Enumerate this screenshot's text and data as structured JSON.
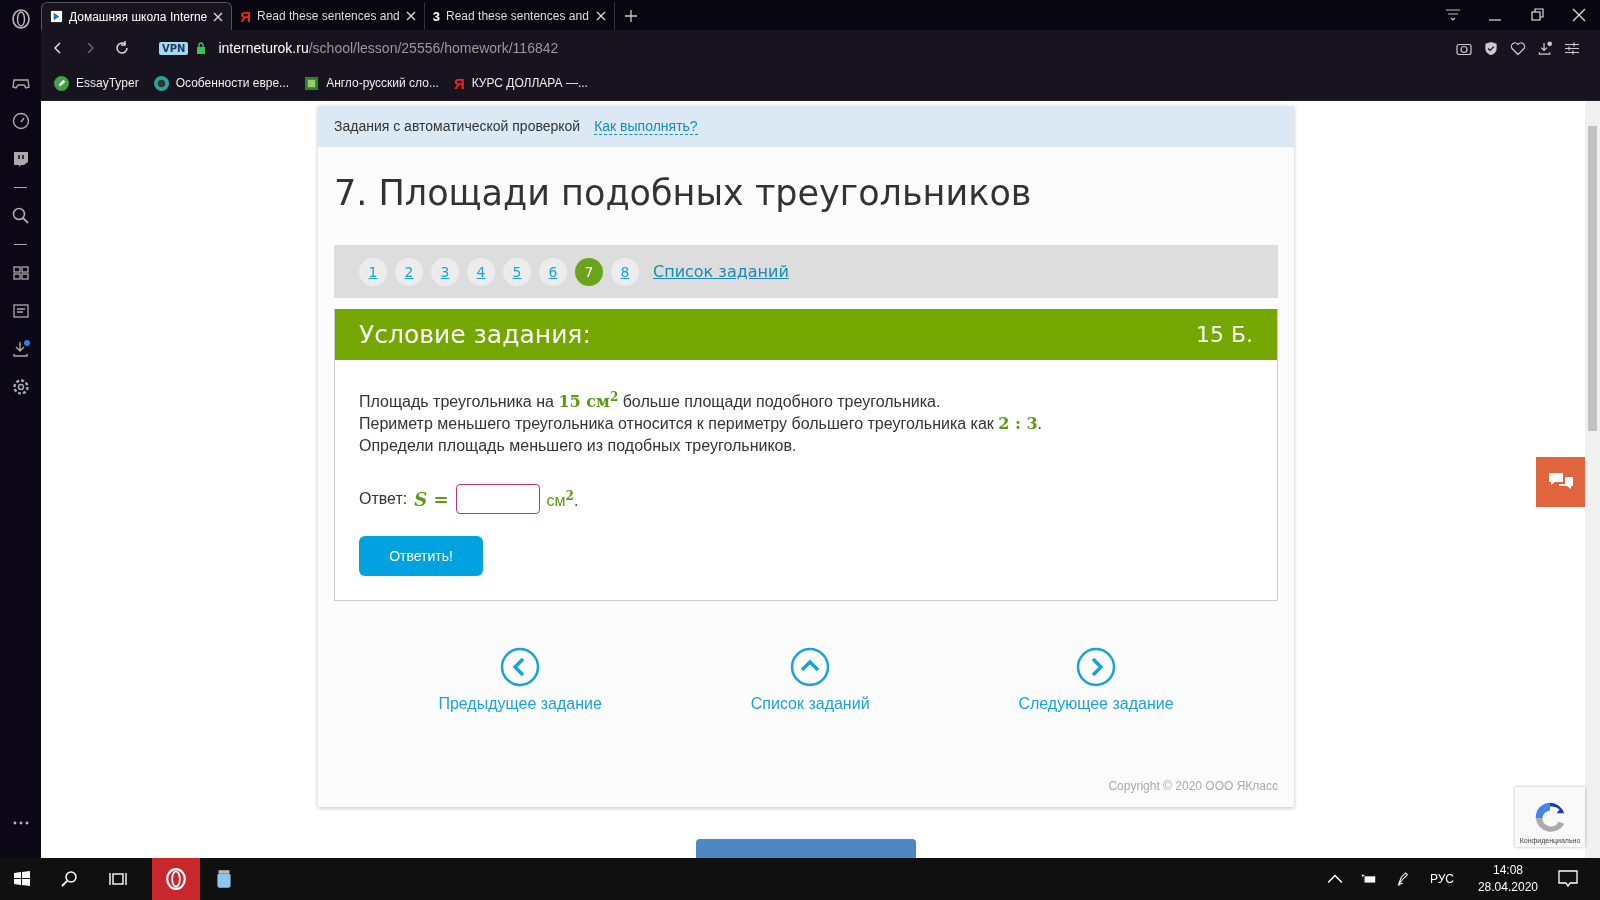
{
  "browser": {
    "tabs": [
      {
        "title": "Домашняя школа Interne",
        "selected": true
      },
      {
        "title": "Read these sentences and",
        "selected": false,
        "glyph": "Я"
      },
      {
        "title": "Read these sentences and",
        "selected": false,
        "glyph": "3"
      }
    ],
    "vpn": "VPN",
    "url_host": "interneturok.ru",
    "url_path": "/school/lesson/25556/homework/116842",
    "bookmarks": [
      {
        "label": "EssayTyper"
      },
      {
        "label": "Особенности евре..."
      },
      {
        "label": "Англо-русский сло..."
      },
      {
        "label": "КУРС ДОЛЛАРА —...",
        "glyph": "Я"
      }
    ]
  },
  "page": {
    "info_bar": {
      "text": "Задания с автоматической проверкой",
      "link": "Как выполнять?"
    },
    "title": "7. Площади подобных треугольников",
    "pager": {
      "pages": [
        {
          "label": "1",
          "selected": false
        },
        {
          "label": "2",
          "selected": false
        },
        {
          "label": "3",
          "selected": false
        },
        {
          "label": "4",
          "selected": false
        },
        {
          "label": "5",
          "selected": false
        },
        {
          "label": "6",
          "selected": false
        },
        {
          "label": "7",
          "selected": true
        },
        {
          "label": "8",
          "selected": false
        }
      ],
      "list_link": "Список заданий"
    },
    "task": {
      "header": "Условие задания:",
      "points": "15 Б.",
      "lines": [
        [
          {
            "kind": "text",
            "text": "Площадь треугольника на "
          },
          {
            "kind": "math",
            "text": "15 см$^{2}$"
          },
          {
            "kind": "text",
            "text": " больше площади подобного треугольника."
          }
        ],
        [
          {
            "kind": "text",
            "text": "Периметр меньшего треугольника относится к периметру большего треугольника как "
          },
          {
            "kind": "math",
            "text": "2 : 3"
          },
          {
            "kind": "text",
            "text": "."
          }
        ],
        [
          {
            "kind": "text",
            "text": "Определи площадь меньшего из подобных треугольников."
          }
        ]
      ],
      "answer_label": "Ответ:",
      "answer_lhs": "S =",
      "answer_unit": "см$^{2}$",
      "answer_end": ".",
      "submit": "Ответить!"
    },
    "nav": [
      {
        "kind": "prev",
        "label": "Предыдущее задание"
      },
      {
        "kind": "up",
        "label": "Список заданий"
      },
      {
        "kind": "next",
        "label": "Следующее задание"
      }
    ],
    "copyright": "Copyright © 2020 ООО ЯКласс",
    "recaptcha": "Конфиденциально"
  },
  "taskbar": {
    "lang": "РУС",
    "time": "14:08",
    "date": "28.04.2020"
  }
}
